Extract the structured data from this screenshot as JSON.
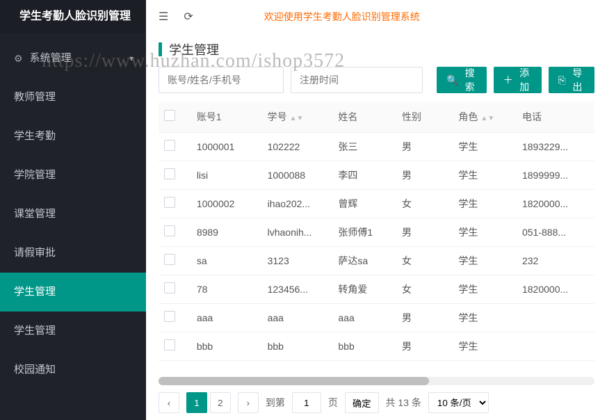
{
  "brand": "学生考勤人脸识别管理",
  "watermark": "https://www.huzhan.com/ishop3572",
  "sidebar": {
    "group_label": "系统管理",
    "items": [
      {
        "label": "教师管理",
        "active": false
      },
      {
        "label": "学生考勤",
        "active": false
      },
      {
        "label": "学院管理",
        "active": false
      },
      {
        "label": "课堂管理",
        "active": false
      },
      {
        "label": "请假审批",
        "active": false
      },
      {
        "label": "学生管理",
        "active": true
      },
      {
        "label": "学生管理",
        "active": false
      },
      {
        "label": "校园通知",
        "active": false
      }
    ]
  },
  "topbar": {
    "welcome": "欢迎使用学生考勤人脸识别管理系统"
  },
  "page": {
    "title": "学生管理"
  },
  "filters": {
    "keyword_placeholder": "账号/姓名/手机号",
    "date_placeholder": "注册时间",
    "search_label": "搜索",
    "add_label": "添加",
    "export_label": "导出"
  },
  "table": {
    "headers": [
      "账号1",
      "学号",
      "姓名",
      "性别",
      "角色",
      "电话"
    ],
    "rows": [
      {
        "account": "1000001",
        "sid": "102222",
        "name": "张三",
        "gender": "男",
        "role": "学生",
        "phone": "1893229..."
      },
      {
        "account": "lisi",
        "sid": "1000088",
        "name": "李四",
        "gender": "男",
        "role": "学生",
        "phone": "1899999..."
      },
      {
        "account": "1000002",
        "sid": "ihao202...",
        "name": "曾辉",
        "gender": "女",
        "role": "学生",
        "phone": "1820000..."
      },
      {
        "account": "8989",
        "sid": "lvhaonih...",
        "name": "张师傅1",
        "gender": "男",
        "role": "学生",
        "phone": "051-888..."
      },
      {
        "account": "sa",
        "sid": "3123",
        "name": "萨达sa",
        "gender": "女",
        "role": "学生",
        "phone": "232"
      },
      {
        "account": "78",
        "sid": "123456...",
        "name": "转角爱",
        "gender": "女",
        "role": "学生",
        "phone": "1820000..."
      },
      {
        "account": "aaa",
        "sid": "aaa",
        "name": "aaa",
        "gender": "男",
        "role": "学生",
        "phone": ""
      },
      {
        "account": "bbb",
        "sid": "bbb",
        "name": "bbb",
        "gender": "男",
        "role": "学生",
        "phone": ""
      }
    ]
  },
  "pagination": {
    "pages": [
      "1",
      "2"
    ],
    "current": 1,
    "goto_prefix": "到第",
    "goto_value": "1",
    "goto_suffix": "页",
    "confirm": "确定",
    "total": "共 13 条",
    "page_size": "10 条/页"
  }
}
